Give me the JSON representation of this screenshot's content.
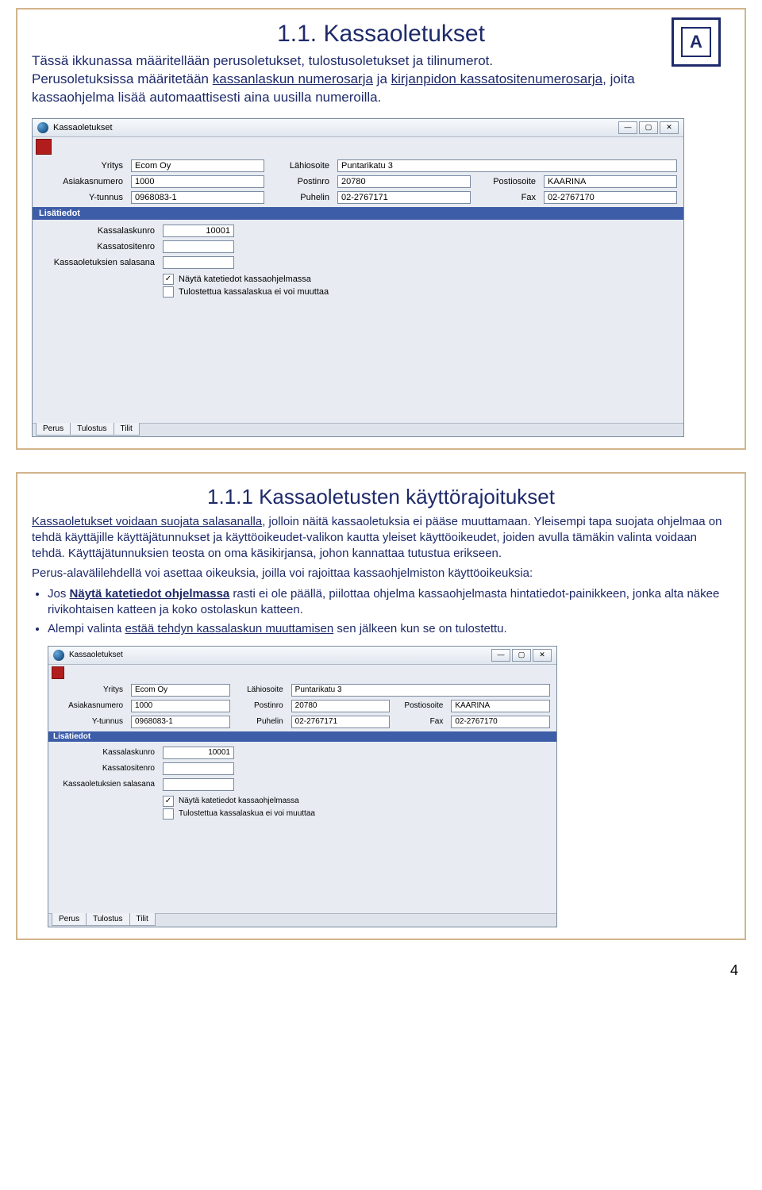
{
  "slide1": {
    "title": "1.1. Kassaoletukset",
    "intro_line1": "Tässä ikkunassa määritellään  perusoletukset, tulostusoletukset ja tilinumerot.",
    "intro_line2a": "Perusoletuksissa määritetään ",
    "intro_line2b": "kassanlaskun numerosarja",
    "intro_line2c": " ja ",
    "intro_line2d": "kirjanpidon kassatositenumerosarja",
    "intro_line2e": ", joita kassaohjelma lisää automaattisesti aina uusilla numeroilla.",
    "logo_letter": "A"
  },
  "slide2": {
    "title": "1.1.1 Kassaoletusten käyttörajoitukset",
    "p1a": "Kassaoletukset voidaan suojata salasanalla",
    "p1b": ", jolloin näitä kassaoletuksia ei pääse muuttamaan. Yleisempi tapa suojata ohjelmaa on tehdä käyttäjille käyttäjätunnukset ja käyttöoikeudet-valikon kautta yleiset  käyttöoikeudet, joiden avulla tämäkin valinta voidaan tehdä. Käyttäjätunnuksien teosta on oma käsikirjansa, johon kannattaa tutustua erikseen.",
    "p2": "Perus-alavälilehdellä voi asettaa oikeuksia, joilla voi rajoittaa kassaohjelmiston käyttöoikeuksia:",
    "bullet1a": "Jos ",
    "bullet1b": "Näytä katetiedot ohjelmassa",
    "bullet1c": " rasti ei ole päällä, piilottaa ohjelma kassaohjelmasta hintatiedot-painikkeen, jonka alta näkee rivikohtaisen katteen ja koko ostolaskun katteen.",
    "bullet2a": "Alempi valinta ",
    "bullet2b": "estää tehdyn kassalaskun muuttamisen",
    "bullet2c": " sen jälkeen kun se on tulostettu."
  },
  "app": {
    "title": "Kassaoletukset",
    "win_min": "—",
    "win_max": "▢",
    "win_close": "✕",
    "labels": {
      "yritys": "Yritys",
      "asiakasnumero": "Asiakasnumero",
      "ytunnus": "Y-tunnus",
      "lahiosoite": "Lähiosoite",
      "postinro": "Postinro",
      "postiosoite": "Postiosoite",
      "puhelin": "Puhelin",
      "fax": "Fax",
      "lisatiedot": "Lisätiedot",
      "kassalaskunro": "Kassalaskunro",
      "kassatositenro": "Kassatositenro",
      "salasana": "Kassaoletuksien salasana",
      "chk1": "Näytä katetiedot kassaohjelmassa",
      "chk2": "Tulostettua kassalaskua ei voi muuttaa"
    },
    "values": {
      "yritys": "Ecom Oy",
      "asiakasnumero": "1000",
      "ytunnus": "0968083-1",
      "lahiosoite": "Puntarikatu 3",
      "postinro": "20780",
      "postiosoite": "KAARINA",
      "puhelin": "02-2767171",
      "fax": "02-2767170",
      "kassalaskunro": "10001",
      "kassatositenro": "",
      "salasana": ""
    },
    "tabs": {
      "perus": "Perus",
      "tulostus": "Tulostus",
      "tilit": "Tilit"
    }
  },
  "page_number": "4"
}
